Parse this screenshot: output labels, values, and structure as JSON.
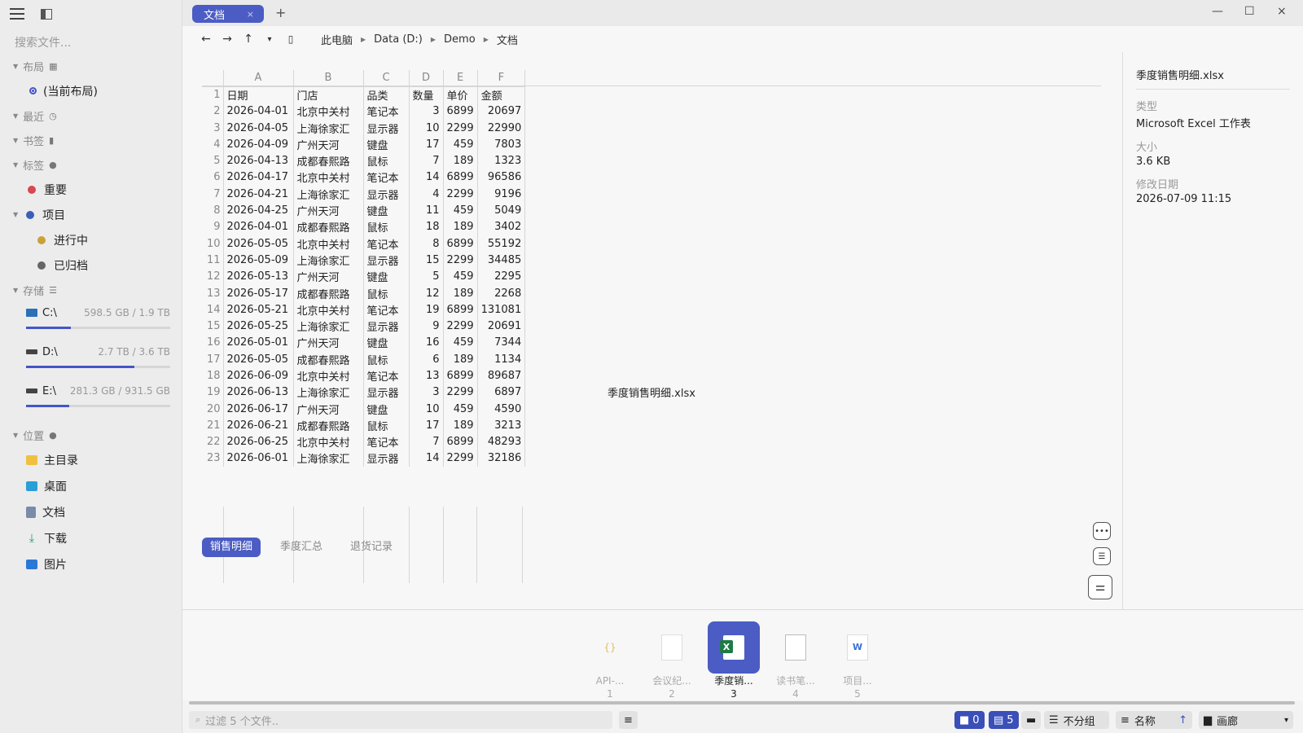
{
  "sidebar": {
    "search_placeholder": "搜索文件...",
    "layout": {
      "label": "布局",
      "current": "(当前布局)"
    },
    "recent": {
      "label": "最近"
    },
    "bookmarks": {
      "label": "书签"
    },
    "tags": {
      "label": "标签",
      "items": [
        {
          "label": "重要",
          "color": "#d9474f"
        },
        {
          "label": "项目",
          "color": "#3a5fb8"
        },
        {
          "label": "进行中",
          "color": "#c9a23a"
        },
        {
          "label": "已归档",
          "color": "#666666"
        }
      ]
    },
    "storage": {
      "label": "存储",
      "drives": [
        {
          "name": "C:\\",
          "size": "598.5 GB / 1.9 TB",
          "used_fraction": 0.31
        },
        {
          "name": "D:\\",
          "size": "2.7 TB / 3.6 TB",
          "used_fraction": 0.75
        },
        {
          "name": "E:\\",
          "size": "281.3 GB / 931.5 GB",
          "used_fraction": 0.3
        }
      ]
    },
    "locations": {
      "label": "位置",
      "items": [
        {
          "label": "主目录",
          "icon": "folder-icon",
          "color": "#f0c040"
        },
        {
          "label": "桌面",
          "icon": "desktop-icon",
          "color": "#2a9fd6"
        },
        {
          "label": "文档",
          "icon": "document-icon",
          "color": "#7a8aa8"
        },
        {
          "label": "下载",
          "icon": "download-icon",
          "color": "#2a9a6a"
        },
        {
          "label": "图片",
          "icon": "pictures-icon",
          "color": "#2a78d6"
        }
      ]
    }
  },
  "tabs": [
    {
      "label": "文档",
      "close": "×"
    }
  ],
  "new_tab": "+",
  "window_controls": {
    "minimize": "—",
    "maximize": "☐",
    "close": "×"
  },
  "nav": {
    "back": "←",
    "forward": "→",
    "up": "↑",
    "history": "▾",
    "bookmark": "🔖",
    "breadcrumbs": [
      "此电脑",
      "Data (D:)",
      "Demo",
      "文档"
    ]
  },
  "spreadsheet": {
    "columns": [
      "A",
      "B",
      "C",
      "D",
      "E",
      "F"
    ],
    "rows": [
      [
        "1",
        "日期",
        "门店",
        "品类",
        "数量",
        "单价",
        "金额"
      ],
      [
        "2",
        "2026-04-01",
        "北京中关村",
        "笔记本",
        "3",
        "6899",
        "20697"
      ],
      [
        "3",
        "2026-04-05",
        "上海徐家汇",
        "显示器",
        "10",
        "2299",
        "22990"
      ],
      [
        "4",
        "2026-04-09",
        "广州天河",
        "键盘",
        "17",
        "459",
        "7803"
      ],
      [
        "5",
        "2026-04-13",
        "成都春熙路",
        "鼠标",
        "7",
        "189",
        "1323"
      ],
      [
        "6",
        "2026-04-17",
        "北京中关村",
        "笔记本",
        "14",
        "6899",
        "96586"
      ],
      [
        "7",
        "2026-04-21",
        "上海徐家汇",
        "显示器",
        "4",
        "2299",
        "9196"
      ],
      [
        "8",
        "2026-04-25",
        "广州天河",
        "键盘",
        "11",
        "459",
        "5049"
      ],
      [
        "9",
        "2026-04-01",
        "成都春熙路",
        "鼠标",
        "18",
        "189",
        "3402"
      ],
      [
        "10",
        "2026-05-05",
        "北京中关村",
        "笔记本",
        "8",
        "6899",
        "55192"
      ],
      [
        "11",
        "2026-05-09",
        "上海徐家汇",
        "显示器",
        "15",
        "2299",
        "34485"
      ],
      [
        "12",
        "2026-05-13",
        "广州天河",
        "键盘",
        "5",
        "459",
        "2295"
      ],
      [
        "13",
        "2026-05-17",
        "成都春熙路",
        "鼠标",
        "12",
        "189",
        "2268"
      ],
      [
        "14",
        "2026-05-21",
        "北京中关村",
        "笔记本",
        "19",
        "6899",
        "131081"
      ],
      [
        "15",
        "2026-05-25",
        "上海徐家汇",
        "显示器",
        "9",
        "2299",
        "20691"
      ],
      [
        "16",
        "2026-05-01",
        "广州天河",
        "键盘",
        "16",
        "459",
        "7344"
      ],
      [
        "17",
        "2026-05-05",
        "成都春熙路",
        "鼠标",
        "6",
        "189",
        "1134"
      ],
      [
        "18",
        "2026-06-09",
        "北京中关村",
        "笔记本",
        "13",
        "6899",
        "89687"
      ],
      [
        "19",
        "2026-06-13",
        "上海徐家汇",
        "显示器",
        "3",
        "2299",
        "6897"
      ],
      [
        "20",
        "2026-06-17",
        "广州天河",
        "键盘",
        "10",
        "459",
        "4590"
      ],
      [
        "21",
        "2026-06-21",
        "成都春熙路",
        "鼠标",
        "17",
        "189",
        "3213"
      ],
      [
        "22",
        "2026-06-25",
        "北京中关村",
        "笔记本",
        "7",
        "6899",
        "48293"
      ],
      [
        "23",
        "2026-06-01",
        "上海徐家汇",
        "显示器",
        "14",
        "2299",
        "32186"
      ]
    ],
    "sheet_tabs": [
      "销售明细",
      "季度汇总",
      "退货记录"
    ],
    "active_sheet": 0,
    "preview_label": "季度销售明细.xlsx"
  },
  "details": {
    "title": "季度销售明细.xlsx",
    "type_label": "类型",
    "type_value": "Microsoft Excel 工作表",
    "size_label": "大小",
    "size_value": "3.6 KB",
    "modified_label": "修改日期",
    "modified_value": "2026-07-09 11:15"
  },
  "files": [
    {
      "name": "API-...",
      "index": "1",
      "icon": "json-file-icon"
    },
    {
      "name": "会议纪...",
      "index": "2",
      "icon": "text-file-icon"
    },
    {
      "name": "季度销...",
      "index": "3",
      "icon": "excel-file-icon",
      "active": true
    },
    {
      "name": "读书笔...",
      "index": "4",
      "icon": "note-file-icon"
    },
    {
      "name": "项目...",
      "index": "5",
      "icon": "word-file-icon"
    }
  ],
  "status": {
    "filter_placeholder": "过滤 5 个文件..",
    "folders_count": "0",
    "files_count": "5",
    "group_label": "不分组",
    "sort_label": "名称",
    "sort_dir": "↑",
    "view_label": "画廊",
    "view_caret": "▾"
  },
  "colors": {
    "accent": "#4b5cc4"
  }
}
